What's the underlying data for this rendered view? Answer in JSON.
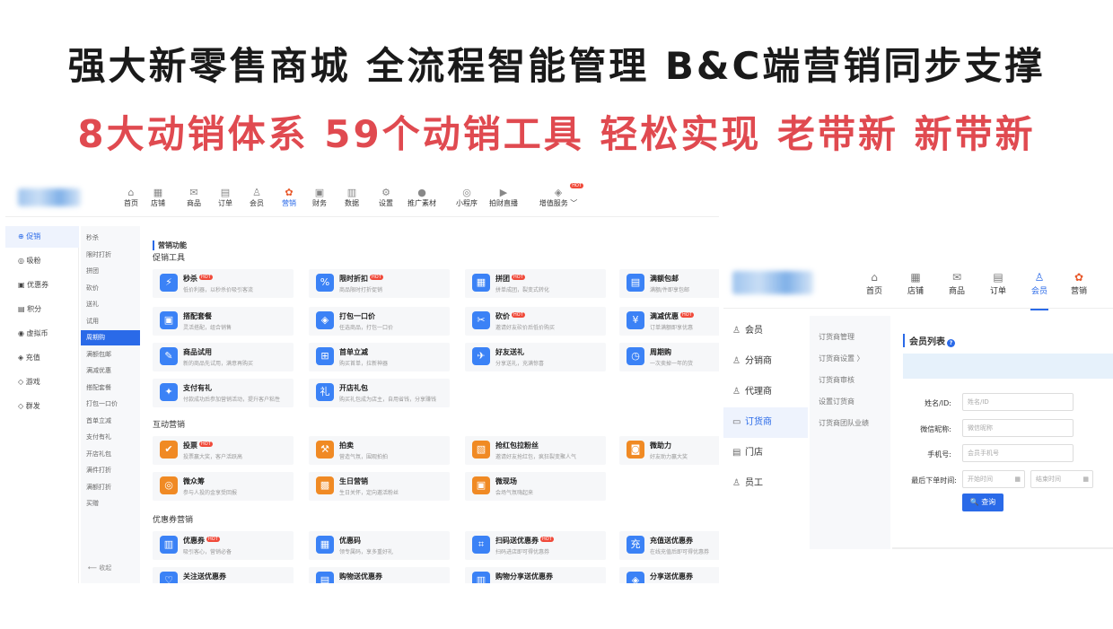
{
  "headline1": "强大新零售商城  全流程智能管理  B&C端营销同步支撑",
  "headline2": "8大动销体系 59个动销工具 轻松实现 老带新 新带新",
  "left": {
    "nav": [
      {
        "label": "首页",
        "icon": "⌂"
      },
      {
        "label": "店铺",
        "icon": "▦"
      },
      {
        "label": "商品",
        "icon": "✉"
      },
      {
        "label": "订单",
        "icon": "▤"
      },
      {
        "label": "会员",
        "icon": "♙"
      },
      {
        "label": "营销",
        "icon": "✿"
      },
      {
        "label": "财务",
        "icon": "▣"
      },
      {
        "label": "数据",
        "icon": "▥"
      },
      {
        "label": "设置",
        "icon": "⚙"
      },
      {
        "label": "推广素材",
        "icon": "●"
      },
      {
        "label": "小程序",
        "icon": "◎"
      },
      {
        "label": "拍财直播",
        "icon": "▶"
      },
      {
        "label": "增值服务 ﹀",
        "icon": "◈"
      }
    ],
    "hot_badge": "HOT",
    "side1": [
      "促销",
      "吸粉",
      "优惠券",
      "积分",
      "虚拟币",
      "充值",
      "游戏",
      "群发"
    ],
    "side2": [
      "秒杀",
      "限时打折",
      "拼团",
      "砍价",
      "送礼",
      "试用",
      "周期购",
      "满额包邮",
      "满减优惠",
      "搭配套餐",
      "打包一口价",
      "首单立减",
      "支付有礼",
      "开店礼包",
      "满件打折",
      "满额打折",
      "买赠"
    ],
    "collapse": "⟵  收起",
    "main_title": "营销功能",
    "sections": [
      "促销工具",
      "互动营销",
      "优惠券营销"
    ],
    "cards": [
      {
        "title": "秒杀",
        "desc": "低价利器，以秒杀价吸引客流",
        "hot": true,
        "color": "#3b82f6",
        "icon": "⚡"
      },
      {
        "title": "限时折扣",
        "desc": "商品限时打折促销",
        "hot": true,
        "color": "#3b82f6",
        "icon": "%"
      },
      {
        "title": "拼团",
        "desc": "拼单成团，裂变式转化",
        "hot": true,
        "color": "#3b82f6",
        "icon": "▦"
      },
      {
        "title": "满额包邮",
        "desc": "满额/件即享包邮",
        "hot": false,
        "color": "#3b82f6",
        "icon": "▤"
      },
      {
        "title": "搭配套餐",
        "desc": "灵活搭配，组合销售",
        "hot": false,
        "color": "#3b82f6",
        "icon": "▣"
      },
      {
        "title": "打包一口价",
        "desc": "任选商品，打包一口价",
        "hot": false,
        "color": "#3b82f6",
        "icon": "◈"
      },
      {
        "title": "砍价",
        "desc": "邀请好友砍价后低价购买",
        "hot": true,
        "color": "#3b82f6",
        "icon": "✂"
      },
      {
        "title": "满减优惠",
        "desc": "订单满额即享优惠",
        "hot": true,
        "color": "#3b82f6",
        "icon": "¥"
      },
      {
        "title": "商品试用",
        "desc": "新的商品先试用，满意再购买",
        "hot": false,
        "color": "#3b82f6",
        "icon": "✎"
      },
      {
        "title": "首单立减",
        "desc": "购买首单，拉新神器",
        "hot": false,
        "color": "#3b82f6",
        "icon": "⊞"
      },
      {
        "title": "好友送礼",
        "desc": "分享送礼，充满惊喜",
        "hot": false,
        "color": "#3b82f6",
        "icon": "✈"
      },
      {
        "title": "周期购",
        "desc": "一次卖掉一年的货",
        "hot": false,
        "color": "#3b82f6",
        "icon": "◷"
      },
      {
        "title": "支付有礼",
        "desc": "付款成功后参加营销活动，提升客户粘性",
        "hot": false,
        "color": "#3b82f6",
        "icon": "✦"
      },
      {
        "title": "开店礼包",
        "desc": "购买礼包成为店主，自用省钱，分享赚钱",
        "hot": false,
        "color": "#3b82f6",
        "icon": "礼"
      },
      {
        "title": "投票",
        "desc": "投票赢大奖，客户活跃高",
        "hot": true,
        "color": "#f08a24",
        "icon": "✔"
      },
      {
        "title": "拍卖",
        "desc": "营造气氛，围观拍拍",
        "hot": false,
        "color": "#f08a24",
        "icon": "⚒"
      },
      {
        "title": "抢红包拉粉丝",
        "desc": "邀请好友抢红包，疯狂裂变聚人气",
        "hot": false,
        "color": "#f08a24",
        "icon": "▧"
      },
      {
        "title": "微助力",
        "desc": "好友助力赢大奖",
        "hot": false,
        "color": "#f08a24",
        "icon": "◙"
      },
      {
        "title": "微众筹",
        "desc": "参与人投的金享受回报",
        "hot": false,
        "color": "#f08a24",
        "icon": "◎"
      },
      {
        "title": "生日营销",
        "desc": "生日关怀，定向邀活粉丝",
        "hot": false,
        "color": "#f08a24",
        "icon": "▩"
      },
      {
        "title": "微现场",
        "desc": "会场气氛嗨起来",
        "hot": false,
        "color": "#f08a24",
        "icon": "▣"
      },
      {
        "title": "优惠券",
        "desc": "吸引客心，营销必备",
        "hot": true,
        "color": "#3b82f6",
        "icon": "▥"
      },
      {
        "title": "优惠码",
        "desc": "领专属码，享多重好礼",
        "hot": false,
        "color": "#3b82f6",
        "icon": "▦"
      },
      {
        "title": "扫码送优惠券",
        "desc": "扫码进店即可得优惠券",
        "hot": true,
        "color": "#3b82f6",
        "icon": "⌗"
      },
      {
        "title": "充值送优惠券",
        "desc": "在线充值后即可得优惠券",
        "hot": false,
        "color": "#3b82f6",
        "icon": "充"
      },
      {
        "title": "关注送优惠券",
        "desc": "",
        "hot": false,
        "color": "#3b82f6",
        "icon": "♡"
      },
      {
        "title": "购物送优惠券",
        "desc": "",
        "hot": false,
        "color": "#3b82f6",
        "icon": "▤"
      },
      {
        "title": "购物分享送优惠券",
        "desc": "",
        "hot": false,
        "color": "#3b82f6",
        "icon": "▥"
      },
      {
        "title": "分享送优惠券",
        "desc": "",
        "hot": false,
        "color": "#3b82f6",
        "icon": "◈"
      }
    ]
  },
  "right": {
    "nav": [
      {
        "label": "首页",
        "icon": "⌂"
      },
      {
        "label": "店铺",
        "icon": "▦"
      },
      {
        "label": "商品",
        "icon": "✉"
      },
      {
        "label": "订单",
        "icon": "▤"
      },
      {
        "label": "会员",
        "icon": "♙"
      },
      {
        "label": "营销",
        "icon": "✿"
      }
    ],
    "side1": [
      {
        "label": "会员",
        "icon": "♙"
      },
      {
        "label": "分销商",
        "icon": "♙"
      },
      {
        "label": "代理商",
        "icon": "♙"
      },
      {
        "label": "订货商",
        "icon": "▭"
      },
      {
        "label": "门店",
        "icon": "▤"
      },
      {
        "label": "员工",
        "icon": "♙"
      }
    ],
    "side2": [
      "订货商管理",
      "订货商设置  〉",
      "订货商审核",
      "设置订货商",
      "订货商团队业绩"
    ],
    "title": "会员列表",
    "help": "?",
    "fields": {
      "name_label": "姓名/ID:",
      "name_ph": "姓名/ID",
      "nick_label": "微信昵称:",
      "nick_ph": "微信昵称",
      "phone_label": "手机号:",
      "phone_ph": "会员手机号",
      "order_label": "最后下单时间:",
      "start_ph": "开始时间",
      "end_ph": "结束时间"
    },
    "query": "🔍 查询"
  }
}
